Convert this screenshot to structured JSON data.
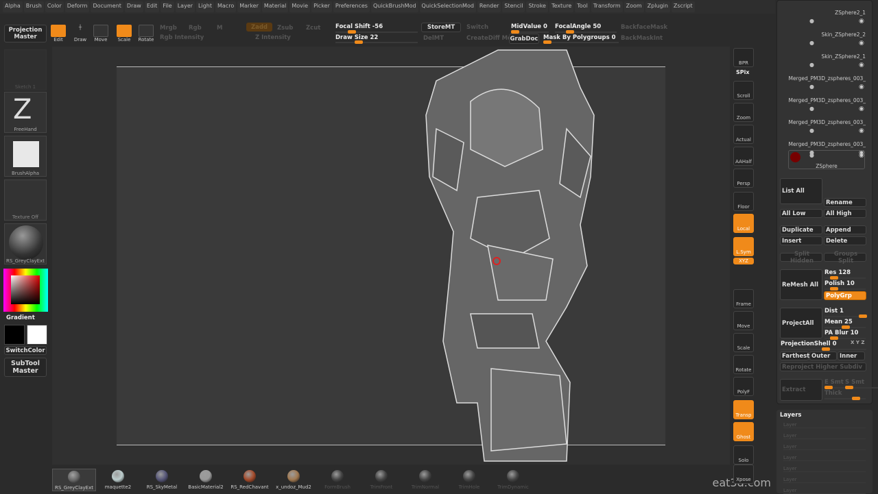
{
  "menu": [
    "Alpha",
    "Brush",
    "Color",
    "Deform",
    "Document",
    "Draw",
    "Edit",
    "File",
    "Layer",
    "Light",
    "Macro",
    "Marker",
    "Material",
    "Movie",
    "Picker",
    "Preferences",
    "QuickBrushMod",
    "QuickSelectionMod",
    "Render",
    "Stencil",
    "Stroke",
    "Texture",
    "Tool",
    "Transform",
    "Zoom",
    "Zplugin",
    "Zscript"
  ],
  "toolbar": {
    "projection_master": "Projection Master",
    "edit": "Edit",
    "draw": "Draw",
    "move": "Move",
    "scale": "Scale",
    "rotate": "Rotate",
    "mrgb": "Mrgb",
    "rgb": "Rgb",
    "m": "M",
    "rgb_intensity": "Rgb Intensity",
    "zadd": "Zadd",
    "zsub": "Zsub",
    "zcut": "Zcut",
    "z_intensity": "Z Intensity",
    "focal_shift": "Focal Shift -56",
    "draw_size": "Draw Size 22",
    "storemt": "StoreMT",
    "delmt": "DelMT",
    "switch": "Switch",
    "creatediff": "CreateDiff Mesh",
    "midvalue": "MidValue 0",
    "grabdoc": "GrabDoc",
    "focal_angle": "FocalAngle 50",
    "mask_polygroups": "Mask By Polygroups 0",
    "backface": "BackfaceMask",
    "backmaskint": "BackMaskInt",
    "focal_shift_value": -56,
    "draw_size_value": 22
  },
  "left": {
    "sketch": "Sketch 1",
    "freehand": "FreeHand",
    "brushalpha": "BrushAlpha",
    "texture": "Texture Off",
    "material": "RS_GreyClayExt",
    "gradient": "Gradient",
    "switchcolor": "SwitchColor",
    "subtool_master": "SubTool Master"
  },
  "right_shelf": [
    "BPR",
    "SPix",
    "Scroll",
    "Zoom",
    "Actual",
    "AAHalf",
    "Persp",
    "Floor",
    "Local",
    "L.Sym",
    "XYZ",
    "Frame",
    "Move",
    "Scale",
    "Rotate",
    "PolyF",
    "Transp",
    "Ghost",
    "Solo",
    "Xpose"
  ],
  "subtools": [
    "ZSphere2_1",
    "Skin_ZSphere2_2",
    "Skin_ZSphere2_1",
    "Merged_PM3D_zspheres_003_",
    "Merged_PM3D_zspheres_003_",
    "Merged_PM3D_zspheres_003_",
    "Merged_PM3D_zspheres_003_",
    "ZSphere"
  ],
  "subtool_panel": {
    "list_all": "List All",
    "rename": "Rename",
    "all_low": "All Low",
    "all_high": "All High",
    "duplicate": "Duplicate",
    "append": "Append",
    "insert": "Insert",
    "delete": "Delete",
    "split_hidden": "Split Hidden",
    "groups_split": "Groups Split",
    "remesh_all": "ReMesh All",
    "res": "Res 128",
    "polish": "Polish 10",
    "polygrp": "PolyGrp",
    "project_all": "ProjectAll",
    "dist": "Dist 1",
    "mean": "Mean 25",
    "pa_blur": "PA Blur 10",
    "projection_shell": "ProjectionShell 0",
    "xyz": "X Y Z",
    "farthest": "Farthest",
    "outer": "Outer",
    "inner": "Inner",
    "reproject": "Reproject Higher Subdiv",
    "extract": "Extract",
    "e_smt": "E Smt",
    "s_smt": "S Smt",
    "thick": "Thick"
  },
  "layers": {
    "title": "Layers",
    "items": [
      "Layer",
      "Layer",
      "Layer",
      "Layer",
      "Layer",
      "Layer",
      "Layer"
    ]
  },
  "materials": [
    {
      "name": "RS_GreyClayExt",
      "color": "#666"
    },
    {
      "name": "maquette2",
      "color": "#bcc"
    },
    {
      "name": "RS_SkyMetal",
      "color": "#557"
    },
    {
      "name": "BasicMaterial2",
      "color": "#999"
    },
    {
      "name": "RS_RedChavant",
      "color": "#a44a2a"
    },
    {
      "name": "x_undoz_Mud2",
      "color": "#a07850"
    },
    {
      "name": "FormBrush",
      "color": "#444"
    },
    {
      "name": "TrimFront",
      "color": "#444"
    },
    {
      "name": "TrimNormal",
      "color": "#444"
    },
    {
      "name": "TrimHole",
      "color": "#444"
    },
    {
      "name": "TrimDynamic",
      "color": "#444"
    }
  ],
  "watermark": "eat3d.com",
  "colors": {
    "accent": "#f08a1a"
  }
}
